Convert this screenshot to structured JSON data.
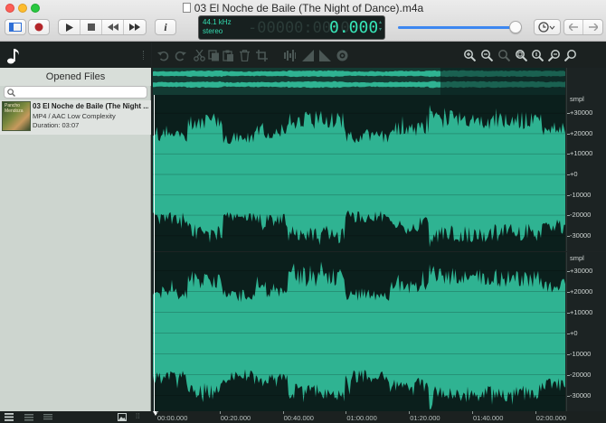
{
  "window": {
    "title": "03 El Noche de Baile (The Night of Dance).m4a"
  },
  "display": {
    "sample_rate": "44.1 kHz",
    "channels": "stereo",
    "time_ghost": "-00000:00:0",
    "time": "0.000",
    "volume_fraction": 0.97
  },
  "sidebar": {
    "header": "Opened Files",
    "search_placeholder": "",
    "files": [
      {
        "name": "03 El Noche de Baile (The Night ...",
        "format": "MP4 / AAC Low Complexity",
        "duration": "Duration: 03:07",
        "thumb_text": "Pancho Mendoza"
      }
    ]
  },
  "ruler": {
    "unit": "smpl",
    "labels": [
      "+30000",
      "+20000",
      "+10000",
      "+0",
      "-10000",
      "-20000",
      "-30000"
    ]
  },
  "timeline": {
    "labels": [
      "00:00.000",
      "00:20.000",
      "00:40.000",
      "01:00.000",
      "01:20.000",
      "01:40.000",
      "02:00.000"
    ]
  },
  "colors": {
    "waveform": "#2fb392",
    "waveform_bg": "#0b1f1c",
    "accent": "#3d87f0"
  }
}
